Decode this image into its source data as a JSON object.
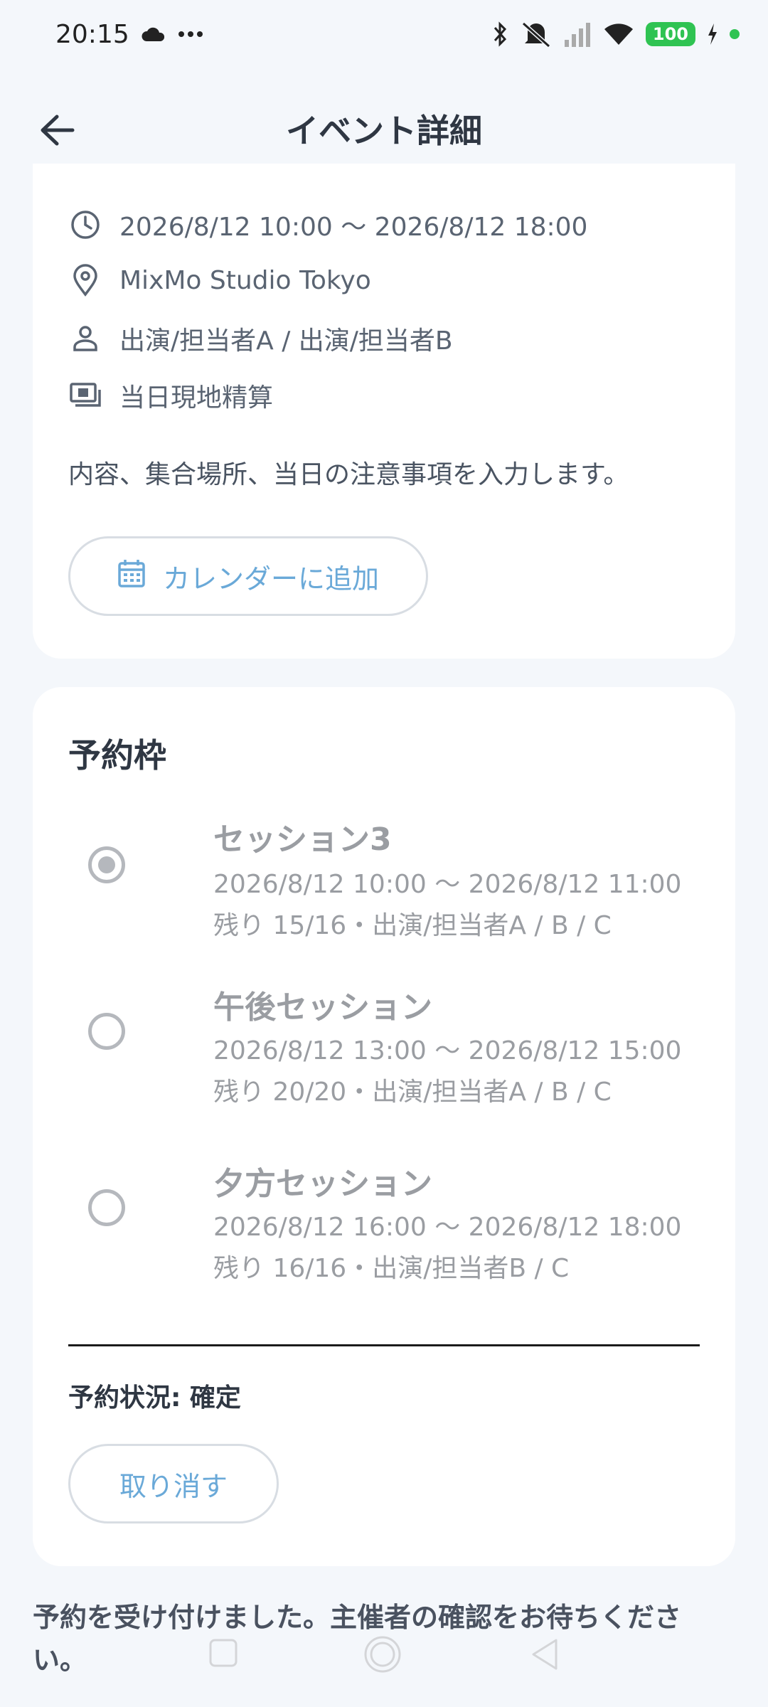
{
  "status_bar": {
    "time": "20:15",
    "battery": "100",
    "icons": [
      "cloud-icon",
      "more-icon",
      "bluetooth-icon",
      "mute-icon",
      "signal-icon",
      "wifi-icon",
      "charging-icon"
    ]
  },
  "header": {
    "title": "イベント詳細",
    "back_icon": "arrow-left-icon"
  },
  "event": {
    "datetime": "2026/8/12 10:00 〜 2026/8/12 18:00",
    "location": "MixMo Studio Tokyo",
    "performers": "出演/担当者A / 出演/担当者B",
    "payment": "当日現地精算",
    "description": "内容、集合場所、当日の注意事項を入力します。",
    "calendar_button": "カレンダーに追加"
  },
  "reservation": {
    "section_title": "予約枠",
    "slots": [
      {
        "title": "セッション3",
        "time": "2026/8/12 10:00 〜 2026/8/12 11:00",
        "detail": "残り 15/16・出演/担当者A / B / C",
        "selected": true
      },
      {
        "title": "午後セッション",
        "time": "2026/8/12 13:00 〜 2026/8/12 15:00",
        "detail": "残り 20/20・出演/担当者A / B / C",
        "selected": false
      },
      {
        "title": "夕方セッション",
        "time": "2026/8/12 16:00 〜 2026/8/12 18:00",
        "detail": "残り 16/16・出演/担当者B / C",
        "selected": false
      }
    ],
    "status_text": "予約状況: 確定",
    "cancel_button": "取り消す"
  },
  "toast": {
    "message": "予約を受け付けました。主催者の確認をお待ちください。"
  },
  "colors": {
    "accent": "#6aa9d8",
    "background": "#f4f7fb",
    "card": "#ffffff",
    "muted": "#9a9da2",
    "battery": "#2fc352"
  }
}
